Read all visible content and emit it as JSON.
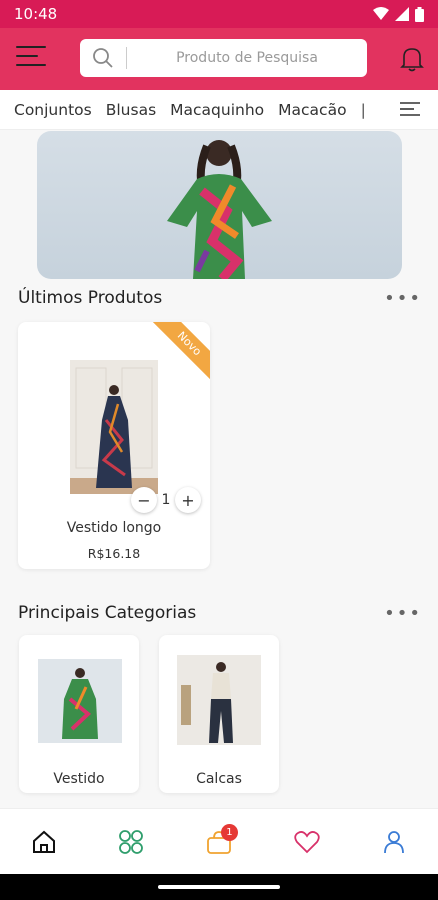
{
  "status_bar": {
    "time": "10:48"
  },
  "search": {
    "placeholder": "Produto de Pesquisa"
  },
  "categories": [
    "Conjuntos",
    "Blusas",
    "Macaquinho",
    "Macacão"
  ],
  "latest": {
    "title": "Últimos Produtos",
    "product": {
      "name": "Vestido longo",
      "price": "R$16.18",
      "quantity": "1",
      "ribbon": "Novo"
    }
  },
  "top_categories": {
    "title": "Principais Categorias",
    "items": [
      {
        "name": "Vestido"
      },
      {
        "name": "Calcas"
      }
    ]
  },
  "bottom_nav": {
    "cart_badge": "1"
  },
  "colors": {
    "primary": "#e2335f",
    "status": "#d81b56",
    "ribbon": "#f2a742",
    "badge": "#e53935"
  }
}
